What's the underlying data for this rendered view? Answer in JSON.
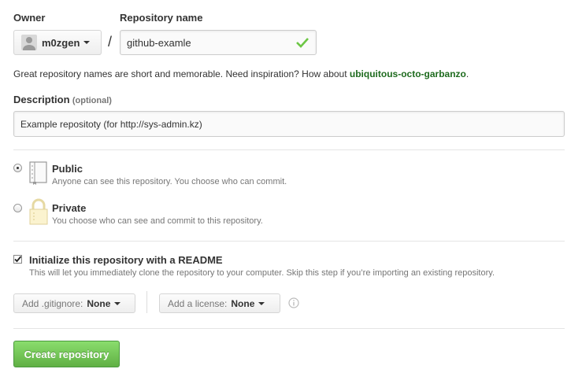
{
  "owner": {
    "label": "Owner",
    "value": "m0zgen"
  },
  "separator": "/",
  "repo": {
    "label": "Repository name",
    "value": "github-examle"
  },
  "hint": {
    "text": "Great repository names are short and memorable. Need inspiration? How about ",
    "suggestion": "ubiquitous-octo-garbanzo",
    "end": "."
  },
  "description": {
    "label": "Description",
    "optional": "(optional)",
    "value": "Example repositoty (for http://sys-admin.kz)"
  },
  "visibility": {
    "public": {
      "title": "Public",
      "desc": "Anyone can see this repository. You choose who can commit.",
      "selected": true
    },
    "private": {
      "title": "Private",
      "desc": "You choose who can see and commit to this repository.",
      "selected": false
    }
  },
  "readme": {
    "checked": true,
    "title": "Initialize this repository with a README",
    "desc": "This will let you immediately clone the repository to your computer. Skip this step if you’re importing an existing repository."
  },
  "gitignore": {
    "prefix": "Add .gitignore:",
    "value": "None"
  },
  "license": {
    "prefix": "Add a license:",
    "value": "None"
  },
  "submit": {
    "label": "Create repository"
  },
  "colors": {
    "suggestion": "#1e6b1e",
    "submit": "#60b044",
    "check": "#6cc644"
  }
}
